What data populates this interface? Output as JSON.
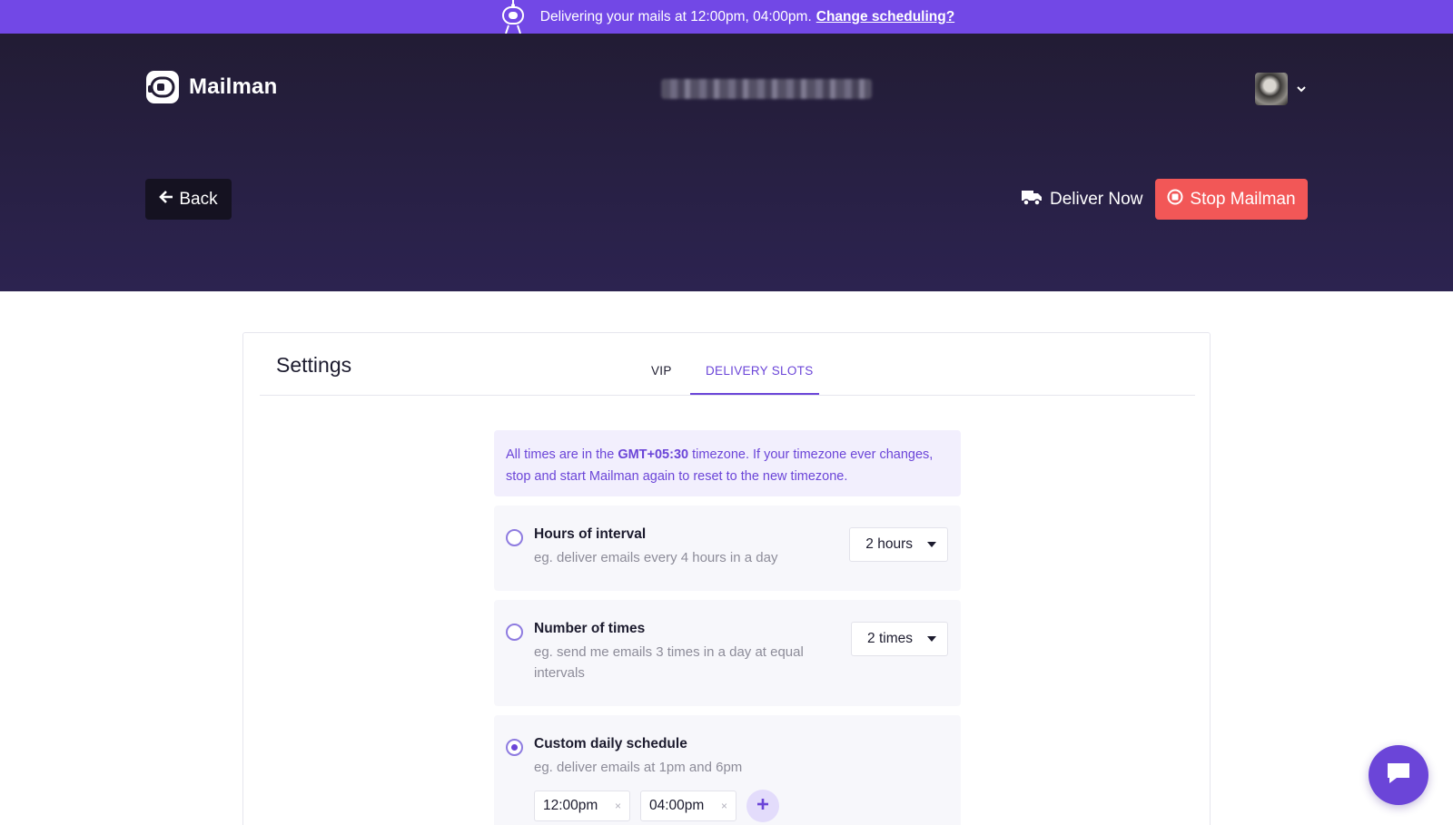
{
  "banner": {
    "text": "Delivering your mails at 12:00pm, 04:00pm.",
    "link": "Change scheduling?",
    "icon": "robot-icon"
  },
  "header": {
    "app_name": "Mailman",
    "logo_icon": "mailman-logo-icon",
    "user_menu_icon": "chevron-down-icon"
  },
  "actions": {
    "back_label": "Back",
    "deliver_label": "Deliver Now",
    "stop_label": "Stop Mailman"
  },
  "settings": {
    "title": "Settings",
    "tabs": [
      {
        "label": "VIP",
        "active": false
      },
      {
        "label": "DELIVERY SLOTS",
        "active": true
      }
    ],
    "info": {
      "prefix": "All times are in the",
      "timezone": "GMT+05:30",
      "suffix": "timezone. If your timezone ever changes, stop and start Mailman again to reset to the new timezone."
    },
    "options": [
      {
        "title": "Hours of interval",
        "desc": "eg. deliver emails every 4 hours in a day",
        "selected": false,
        "value": "2 hours"
      },
      {
        "title": "Number of times",
        "desc": "eg. send me emails 3 times in a day at equal intervals",
        "selected": false,
        "value": "2 times"
      },
      {
        "title": "Custom daily schedule",
        "desc": "eg. deliver emails at 1pm and 6pm",
        "selected": true,
        "slots": [
          "12:00pm",
          "04:00pm"
        ]
      }
    ],
    "remove_symbol": "×"
  },
  "colors": {
    "banner": "#7248e6",
    "accent": "#6b45d8",
    "stop": "#f25757",
    "header_dark": "#221c34"
  }
}
